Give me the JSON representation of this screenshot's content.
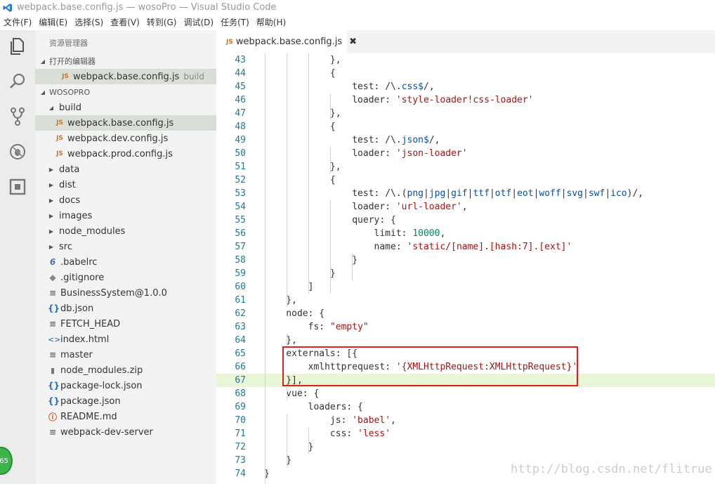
{
  "window": {
    "title": "webpack.base.config.js — wosoPro — Visual Studio Code"
  },
  "menu": [
    "文件(F)",
    "编辑(E)",
    "选择(S)",
    "查看(V)",
    "转到(G)",
    "调试(D)",
    "任务(T)",
    "帮助(H)"
  ],
  "activity_bar": [
    {
      "name": "explorer-icon"
    },
    {
      "name": "search-icon"
    },
    {
      "name": "source-control-icon"
    },
    {
      "name": "debug-icon"
    },
    {
      "name": "extensions-icon"
    }
  ],
  "sidebar": {
    "title": "资源管理器",
    "open_editors": {
      "label": "打开的编辑器",
      "file": "webpack.base.config.js",
      "folder": "build"
    },
    "project": "WOSOPRO",
    "tree": [
      {
        "label": "build",
        "kind": "folder-open",
        "indent": 1
      },
      {
        "label": "webpack.base.config.js",
        "kind": "js",
        "indent": 2,
        "selected": true
      },
      {
        "label": "webpack.dev.config.js",
        "kind": "js",
        "indent": 2
      },
      {
        "label": "webpack.prod.config.js",
        "kind": "js",
        "indent": 2
      },
      {
        "label": "data",
        "kind": "folder",
        "indent": 1
      },
      {
        "label": "dist",
        "kind": "folder",
        "indent": 1
      },
      {
        "label": "docs",
        "kind": "folder",
        "indent": 1
      },
      {
        "label": "images",
        "kind": "folder",
        "indent": 1
      },
      {
        "label": "node_modules",
        "kind": "folder",
        "indent": 1
      },
      {
        "label": "src",
        "kind": "folder",
        "indent": 1
      },
      {
        "label": ".babelrc",
        "kind": "babel",
        "indent": 1
      },
      {
        "label": ".gitignore",
        "kind": "git",
        "indent": 1
      },
      {
        "label": "BusinessSystem@1.0.0",
        "kind": "lines",
        "indent": 1
      },
      {
        "label": "db.json",
        "kind": "json",
        "indent": 1
      },
      {
        "label": "FETCH_HEAD",
        "kind": "lines",
        "indent": 1
      },
      {
        "label": "index.html",
        "kind": "html",
        "indent": 1
      },
      {
        "label": "master",
        "kind": "lines",
        "indent": 1
      },
      {
        "label": "node_modules.zip",
        "kind": "zip",
        "indent": 1
      },
      {
        "label": "package-lock.json",
        "kind": "json",
        "indent": 1
      },
      {
        "label": "package.json",
        "kind": "json",
        "indent": 1
      },
      {
        "label": "README.md",
        "kind": "info",
        "indent": 1
      },
      {
        "label": "webpack-dev-server",
        "kind": "lines",
        "indent": 1
      }
    ]
  },
  "tab": {
    "label": "webpack.base.config.js",
    "icon_text": "JS",
    "close": "✖"
  },
  "icons": {
    "js": "JS",
    "json": "{}",
    "html": "<>",
    "lines": "≡",
    "info": "ⓘ",
    "git": "◆",
    "babel": "6",
    "zip": "▮"
  },
  "badge": "65",
  "watermark": "http://blog.csdn.net/flitrue",
  "code": [
    {
      "n": "43",
      "segs": [
        [
          "            },",
          "p"
        ]
      ]
    },
    {
      "n": "44",
      "segs": [
        [
          "            {",
          "p"
        ]
      ]
    },
    {
      "n": "45",
      "segs": [
        [
          "                test",
          "p"
        ],
        [
          ": /\\.",
          "p"
        ],
        [
          "css$",
          "r"
        ],
        [
          "/,",
          "p"
        ]
      ]
    },
    {
      "n": "46",
      "segs": [
        [
          "                loader",
          "p"
        ],
        [
          ": ",
          "p"
        ],
        [
          "'style-loader!css-loader'",
          "s"
        ]
      ]
    },
    {
      "n": "47",
      "segs": [
        [
          "            },",
          "p"
        ]
      ]
    },
    {
      "n": "48",
      "segs": [
        [
          "            {",
          "p"
        ]
      ]
    },
    {
      "n": "49",
      "segs": [
        [
          "                test",
          "p"
        ],
        [
          ": /\\.",
          "p"
        ],
        [
          "json$",
          "r"
        ],
        [
          "/,",
          "p"
        ]
      ]
    },
    {
      "n": "50",
      "segs": [
        [
          "                loader",
          "p"
        ],
        [
          ": ",
          "p"
        ],
        [
          "'json-loader'",
          "s"
        ]
      ]
    },
    {
      "n": "51",
      "segs": [
        [
          "            },",
          "p"
        ]
      ]
    },
    {
      "n": "52",
      "segs": [
        [
          "            {",
          "p"
        ]
      ]
    },
    {
      "n": "53",
      "segs": [
        [
          "                test",
          "p"
        ],
        [
          ": /\\.(",
          "p"
        ],
        [
          "png",
          "r"
        ],
        [
          "|",
          "p"
        ],
        [
          "jpg",
          "r"
        ],
        [
          "|",
          "p"
        ],
        [
          "gif",
          "r"
        ],
        [
          "|",
          "p"
        ],
        [
          "ttf",
          "r"
        ],
        [
          "|",
          "p"
        ],
        [
          "otf",
          "r"
        ],
        [
          "|",
          "p"
        ],
        [
          "eot",
          "r"
        ],
        [
          "|",
          "p"
        ],
        [
          "woff",
          "r"
        ],
        [
          "|",
          "p"
        ],
        [
          "svg",
          "r"
        ],
        [
          "|",
          "p"
        ],
        [
          "swf",
          "r"
        ],
        [
          "|",
          "p"
        ],
        [
          "ico",
          "r"
        ],
        [
          ")/,",
          "p"
        ]
      ]
    },
    {
      "n": "54",
      "segs": [
        [
          "                loader",
          "p"
        ],
        [
          ": ",
          "p"
        ],
        [
          "'url-loader'",
          "s"
        ],
        [
          ",",
          "p"
        ]
      ]
    },
    {
      "n": "55",
      "segs": [
        [
          "                query",
          "p"
        ],
        [
          ": {",
          "p"
        ]
      ]
    },
    {
      "n": "56",
      "segs": [
        [
          "                    limit",
          "p"
        ],
        [
          ": ",
          "p"
        ],
        [
          "10000",
          "num"
        ],
        [
          ",",
          "p"
        ]
      ]
    },
    {
      "n": "57",
      "segs": [
        [
          "                    name",
          "p"
        ],
        [
          ": ",
          "p"
        ],
        [
          "'static/[name].[hash:7].[ext]'",
          "s"
        ]
      ]
    },
    {
      "n": "58",
      "segs": [
        [
          "                }",
          "p"
        ]
      ]
    },
    {
      "n": "59",
      "segs": [
        [
          "            }",
          "p"
        ]
      ]
    },
    {
      "n": "60",
      "segs": [
        [
          "        ]",
          "p"
        ]
      ]
    },
    {
      "n": "61",
      "segs": [
        [
          "    },",
          "p"
        ]
      ]
    },
    {
      "n": "62",
      "segs": [
        [
          "    node",
          "p"
        ],
        [
          ": {",
          "p"
        ]
      ]
    },
    {
      "n": "63",
      "segs": [
        [
          "        fs",
          "p"
        ],
        [
          ": ",
          "p"
        ],
        [
          "\"empty\"",
          "s"
        ]
      ]
    },
    {
      "n": "64",
      "segs": [
        [
          "    },",
          "p"
        ]
      ]
    },
    {
      "n": "65",
      "segs": [
        [
          "    externals",
          "p"
        ],
        [
          ": [{",
          "p"
        ]
      ]
    },
    {
      "n": "66",
      "segs": [
        [
          "        xmlhttprequest",
          "p"
        ],
        [
          ": ",
          "p"
        ],
        [
          "'{XMLHttpRequest:XMLHttpRequest}'",
          "s"
        ]
      ]
    },
    {
      "n": "67",
      "segs": [
        [
          "    }],",
          "p"
        ]
      ],
      "hl": true
    },
    {
      "n": "68",
      "segs": [
        [
          "    vue",
          "p"
        ],
        [
          ": {",
          "p"
        ]
      ]
    },
    {
      "n": "69",
      "segs": [
        [
          "        loaders",
          "p"
        ],
        [
          ": {",
          "p"
        ]
      ]
    },
    {
      "n": "70",
      "segs": [
        [
          "            js",
          "p"
        ],
        [
          ": ",
          "p"
        ],
        [
          "'babel'",
          "s"
        ],
        [
          ",",
          "p"
        ]
      ]
    },
    {
      "n": "71",
      "segs": [
        [
          "            css",
          "p"
        ],
        [
          ": ",
          "p"
        ],
        [
          "'less'",
          "s"
        ]
      ]
    },
    {
      "n": "72",
      "segs": [
        [
          "        }",
          "p"
        ]
      ]
    },
    {
      "n": "73",
      "segs": [
        [
          "    }",
          "p"
        ]
      ]
    },
    {
      "n": "74",
      "segs": [
        [
          "}",
          "p"
        ]
      ]
    }
  ],
  "colors": {
    "string": "#a31515",
    "regex": "#0451a5",
    "number": "#09885a",
    "plain": "#333333",
    "line_number": "#237893",
    "highlight": "#eaf6d8",
    "box": "#e0201c"
  }
}
